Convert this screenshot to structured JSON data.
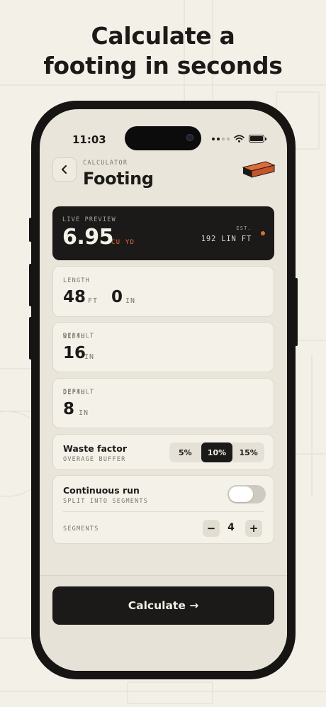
{
  "headline": {
    "line1": "Calculate a",
    "line2": "footing in seconds"
  },
  "status_bar": {
    "time": "11:03",
    "icons": [
      "cellular-icon",
      "wifi-icon",
      "battery-icon"
    ]
  },
  "header": {
    "eyebrow": "CALCULATOR",
    "title": "Footing",
    "back_icon": "chevron-left-icon",
    "illustration": "brick-icon"
  },
  "preview": {
    "label": "LIVE PREVIEW",
    "value": "6.95",
    "unit": "CU YD",
    "est_label": "EST.",
    "linear": "192 LIN FT"
  },
  "length": {
    "label": "LENGTH",
    "feet": "48",
    "feet_unit": "FT",
    "inches": "0",
    "inches_unit": "IN"
  },
  "width": {
    "label": "WIDTH",
    "badge": "DEFAULT",
    "value": "16",
    "unit": "IN"
  },
  "depth": {
    "label": "DEPTH",
    "badge": "DEFAULT",
    "value": "8",
    "unit": "IN"
  },
  "waste": {
    "title": "Waste factor",
    "subtitle": "OVERAGE BUFFER",
    "options": [
      "5%",
      "10%",
      "15%"
    ],
    "selected": "10%"
  },
  "continuous": {
    "title": "Continuous run",
    "subtitle": "SPLIT INTO SEGMENTS",
    "toggle_on": false,
    "segments_label": "SEGMENTS",
    "segments_value": "4",
    "minus": "−",
    "plus": "+"
  },
  "calculate": {
    "label": "Calculate →"
  },
  "colors": {
    "accent": "#e06c3a",
    "dark": "#1c1a18",
    "screen": "#e9e5da",
    "card": "#f4f1e9"
  }
}
